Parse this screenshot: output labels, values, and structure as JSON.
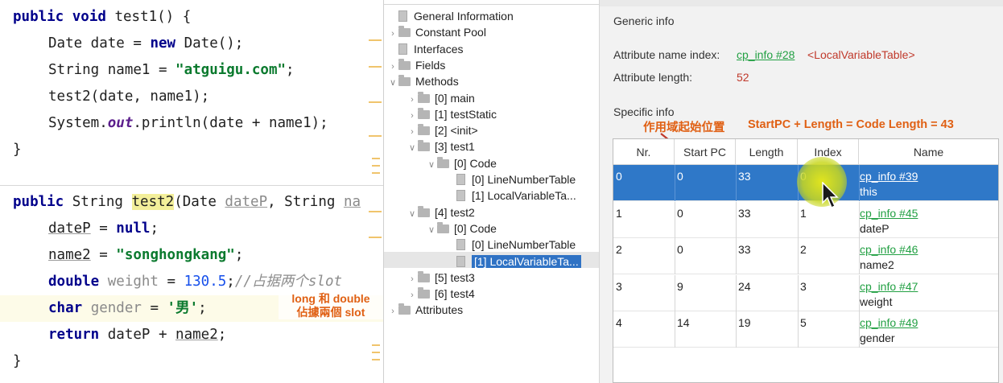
{
  "editor": {
    "method1": {
      "line1": {
        "kw1": "public",
        "kw2": "void",
        "rest": " test1() {"
      },
      "line2": {
        "type": "Date date = ",
        "kw": "new",
        "rest": " Date();"
      },
      "line3": {
        "type": "String name1 = ",
        "str": "\"atguigu.com\"",
        "rest": ";"
      },
      "line4": {
        "text": "test2(date, name1);"
      },
      "line5": {
        "pre": "System.",
        "field": "out",
        "post": ".println(date + name1);"
      },
      "line6": {
        "text": "}"
      }
    },
    "method2": {
      "line1": {
        "kw1": "public",
        "mid": " String ",
        "name": "test2",
        "open": "(Date ",
        "p1": "dateP",
        "sep": ", String ",
        "p2": "na"
      },
      "line2": {
        "var": "dateP",
        "eq": " = ",
        "kw": "null",
        "end": ";"
      },
      "line3": {
        "var": "name2",
        "eq": " = ",
        "str": "\"songhongkang\"",
        "end": ";"
      },
      "line4": {
        "kw": "double",
        "var": " weight",
        "eq": " = ",
        "num": "130.5",
        "end": ";",
        "comment": "//占据两个slot"
      },
      "line5": {
        "kw": "char",
        "var": " gender",
        "eq": " = ",
        "str": "'男'",
        "end": ";"
      },
      "line6": {
        "kw": "return",
        "rest": " dateP + ",
        "var": "name2",
        "end": ";"
      },
      "line7": {
        "text": "}"
      }
    },
    "annotation": {
      "line1": "long 和 double",
      "line2": "佔據兩個 slot"
    }
  },
  "tree": {
    "nodes": [
      {
        "label": "General Information",
        "icon": "file-icon",
        "arrow": ""
      },
      {
        "label": "Constant Pool",
        "icon": "folder-icon",
        "arrow": ">"
      },
      {
        "label": "Interfaces",
        "icon": "file-icon",
        "arrow": ""
      },
      {
        "label": "Fields",
        "icon": "folder-icon",
        "arrow": ">"
      },
      {
        "label": "Methods",
        "icon": "folder-icon",
        "arrow": "v"
      },
      {
        "label": "[0] main",
        "icon": "folder-icon",
        "arrow": ">"
      },
      {
        "label": "[1] testStatic",
        "icon": "folder-icon",
        "arrow": ">"
      },
      {
        "label": "[2] <init>",
        "icon": "folder-icon",
        "arrow": ">"
      },
      {
        "label": "[3] test1",
        "icon": "folder-icon",
        "arrow": "v"
      },
      {
        "label": "[0] Code",
        "icon": "folder-icon",
        "arrow": "v"
      },
      {
        "label": "[0] LineNumberTable",
        "icon": "file-icon",
        "arrow": ""
      },
      {
        "label": "[1] LocalVariableTa...",
        "icon": "file-icon",
        "arrow": ""
      },
      {
        "label": "[4] test2",
        "icon": "folder-icon",
        "arrow": "v"
      },
      {
        "label": "[0] Code",
        "icon": "folder-icon",
        "arrow": "v"
      },
      {
        "label": "[0] LineNumberTable",
        "icon": "file-icon",
        "arrow": ""
      },
      {
        "label": "[1] LocalVariableTa...",
        "icon": "file-icon",
        "arrow": ""
      },
      {
        "label": "[5] test3",
        "icon": "folder-icon",
        "arrow": ">"
      },
      {
        "label": "[6] test4",
        "icon": "folder-icon",
        "arrow": ">"
      },
      {
        "label": "Attributes",
        "icon": "folder-icon",
        "arrow": ">"
      }
    ],
    "selected_index": 15
  },
  "detail": {
    "generic_title": "Generic info",
    "attr_name_label": "Attribute name index:",
    "attr_name_link": "cp_info #28",
    "attr_name_value": "<LocalVariableTable>",
    "attr_length_label": "Attribute length:",
    "attr_length_value": "52",
    "specific_title": "Specific info",
    "annotation_scope": "作用域起始位置",
    "annotation_formula": "StartPC + Length =  Code Length = 43",
    "table": {
      "headers": [
        "Nr.",
        "Start PC",
        "Length",
        "Index",
        "Name"
      ],
      "rows": [
        {
          "nr": "0",
          "start_pc": "0",
          "length": "33",
          "index": "0",
          "name_link": "cp_info #39",
          "name": "this"
        },
        {
          "nr": "1",
          "start_pc": "0",
          "length": "33",
          "index": "1",
          "name_link": "cp_info #45",
          "name": "dateP"
        },
        {
          "nr": "2",
          "start_pc": "0",
          "length": "33",
          "index": "2",
          "name_link": "cp_info #46",
          "name": "name2"
        },
        {
          "nr": "3",
          "start_pc": "9",
          "length": "24",
          "index": "3",
          "name_link": "cp_info #47",
          "name": "weight"
        },
        {
          "nr": "4",
          "start_pc": "14",
          "length": "19",
          "index": "5",
          "name_link": "cp_info #49",
          "name": "gender"
        }
      ],
      "selected_row": 0
    }
  },
  "colors": {
    "keyword": "#00008b",
    "string": "#0b7a2e",
    "number": "#1750eb",
    "link": "#22a043",
    "annotation": "#e06014",
    "selection": "#2f78c8",
    "value_red": "#c0392b"
  }
}
